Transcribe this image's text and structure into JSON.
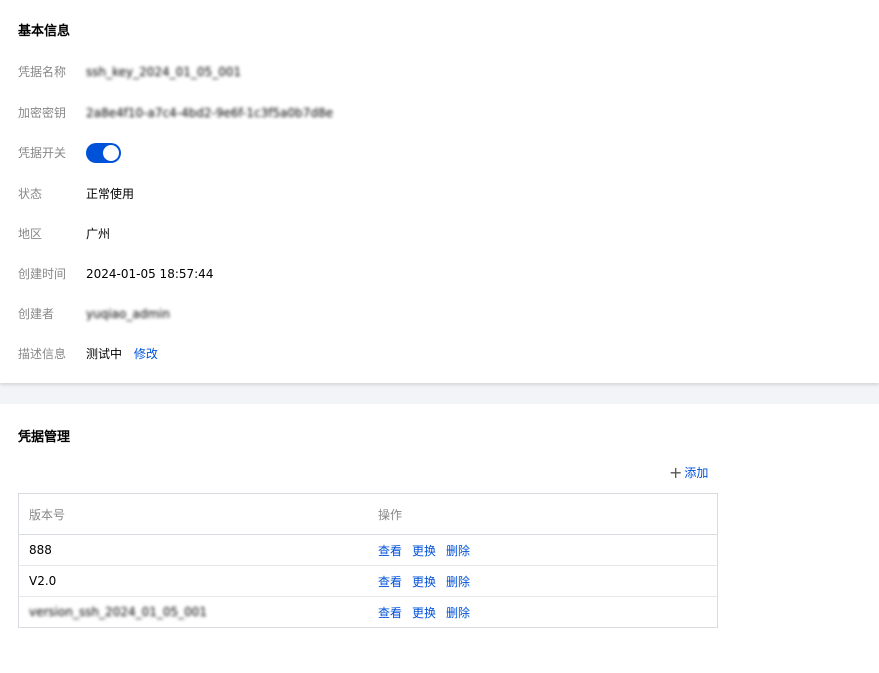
{
  "basic_info": {
    "title": "基本信息",
    "fields": [
      {
        "label": "凭据名称",
        "value": "ssh_key_2024_01_05_001"
      },
      {
        "label": "加密密钥",
        "value": "2a8e4f10-a7c4-4bd2-9e6f-1c3f5a0b7d8e"
      },
      {
        "label": "凭据开关",
        "value": ""
      },
      {
        "label": "状态",
        "value": "正常使用"
      },
      {
        "label": "地区",
        "value": "广州"
      },
      {
        "label": "创建时间",
        "value": "2024-01-05 18:57:44"
      },
      {
        "label": "创建者",
        "value": "yuqiao_admin"
      },
      {
        "label": "描述信息",
        "value": "测试中",
        "action": "修改"
      }
    ],
    "toggle_on": true
  },
  "credential_mgmt": {
    "title": "凭据管理",
    "add_label": "添加",
    "columns": [
      "版本号",
      "操作"
    ],
    "rows": [
      {
        "version": "888",
        "actions": [
          "查看",
          "更换",
          "删除"
        ]
      },
      {
        "version": "V2.0",
        "actions": [
          "查看",
          "更换",
          "删除"
        ]
      },
      {
        "version": "version_ssh_2024_01_05_001",
        "actions": [
          "查看",
          "更换",
          "删除"
        ]
      }
    ]
  },
  "colors": {
    "accent": "#0052d9",
    "label": "#888888",
    "border": "#d8dbe0",
    "page_bg": "#f3f4f7"
  },
  "icons": {
    "add": "plus-icon"
  }
}
